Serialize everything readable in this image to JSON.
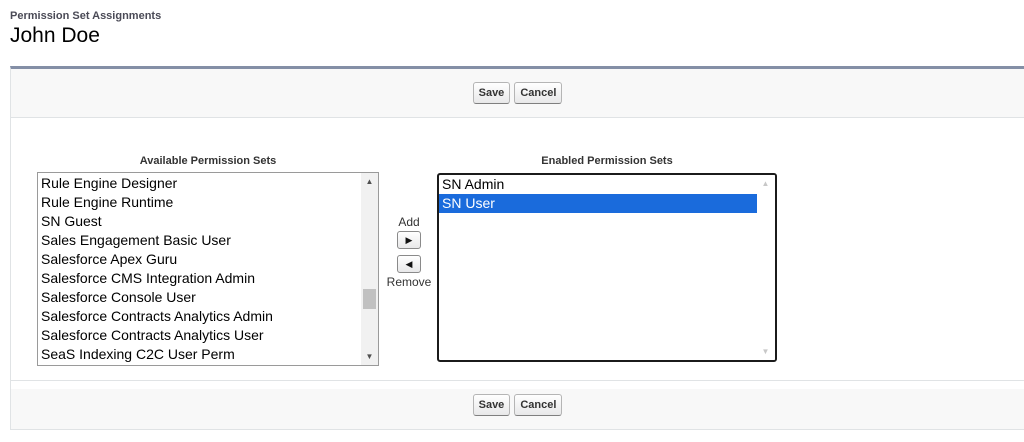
{
  "header": {
    "subtitle": "Permission Set Assignments",
    "title": "John Doe"
  },
  "buttons": {
    "save_label": "Save",
    "cancel_label": "Cancel"
  },
  "available": {
    "label": "Available Permission Sets",
    "items": [
      "Rule Engine Designer",
      "Rule Engine Runtime",
      "SN Guest",
      "Sales Engagement Basic User",
      "Salesforce Apex Guru",
      "Salesforce CMS Integration Admin",
      "Salesforce Console User",
      "Salesforce Contracts Analytics Admin",
      "Salesforce Contracts Analytics User",
      "SeaS Indexing C2C User Perm"
    ],
    "scroll_position_fraction": 0.72
  },
  "enabled": {
    "label": "Enabled Permission Sets",
    "items": [
      "SN Admin",
      "SN User"
    ],
    "selected_index": 1
  },
  "mover": {
    "add_label": "Add",
    "remove_label": "Remove"
  },
  "icons": {
    "add": "triangle-right-icon",
    "remove": "triangle-left-icon",
    "scroll_up": "scroll-up-arrow-icon",
    "scroll_down": "scroll-down-arrow-icon"
  },
  "colors": {
    "selection": "#1a6bdc",
    "panel_accent": "#848fa6"
  }
}
